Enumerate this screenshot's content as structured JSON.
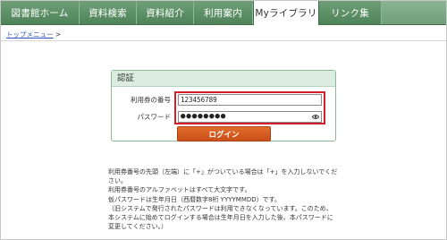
{
  "nav": {
    "tabs": [
      {
        "label": "図書館ホーム"
      },
      {
        "label": "資料検索"
      },
      {
        "label": "資料紹介"
      },
      {
        "label": "利用案内"
      },
      {
        "label": "Myライブラリ",
        "active": true
      },
      {
        "label": "リンク集"
      }
    ]
  },
  "breadcrumb": {
    "link": "トップメニュー",
    "separator": ">"
  },
  "auth": {
    "heading": "認証",
    "card_label": "利用券の番号",
    "card_value": "123456789",
    "password_label": "パスワード",
    "password_value": "●●●●●●●●",
    "login_label": "ログイン"
  },
  "notes": [
    "利用券番号の先頭（左端）に「+」がついている場合は「+」を入力しないでくだ",
    "さい。",
    "利用券番号のアルファベットはすべて大文字です。",
    "仮パスワードは生年月日（西暦数字8桁 YYYYMMDD）です。",
    "（旧システムで発行されたパスワードは利用できなくなっています。このため、",
    "本システムに始めてログインする場合は生年月日を入力した後、本パスワードに",
    "変更してください。）"
  ],
  "colors": {
    "nav_green": "#5a8f64",
    "highlight_red": "#d41e2a",
    "login_orange": "#d85c20"
  }
}
